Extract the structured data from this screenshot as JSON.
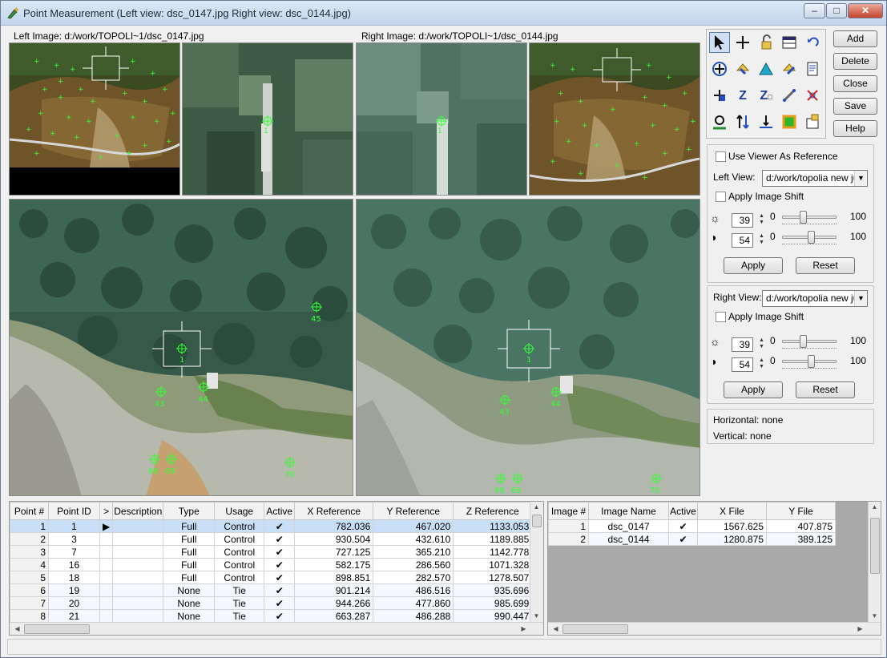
{
  "window": {
    "title": "Point Measurement (Left view: dsc_0147.jpg  Right view: dsc_0144.jpg)",
    "minimize": "–",
    "maximize": "□",
    "close": "✕"
  },
  "left_image_label": "Left Image: d:/work/TOPOLI~1/dsc_0147.jpg",
  "right_image_label": "Right Image: d:/work/TOPOLI~1/dsc_0144.jpg",
  "main_view_points": {
    "left": [
      "1",
      "45",
      "43",
      "44",
      "68",
      "69",
      "70"
    ],
    "right": [
      "1",
      "43",
      "44",
      "68",
      "69",
      "70"
    ]
  },
  "buttons": {
    "add": "Add",
    "delete": "Delete",
    "close": "Close",
    "save": "Save",
    "help": "Help"
  },
  "toolbar_icons": [
    "select-arrow-icon",
    "crosshair-icon",
    "lock-icon",
    "table-view-icon",
    "undo-icon",
    "drive-icon",
    "create-point-icon",
    "triangle-icon",
    "copy-point-icon",
    "report-icon",
    "add-point-icon",
    "z-value-icon",
    "z-update-icon",
    "link-icon",
    "delete-point-icon",
    "navigate-icon",
    "swap-icon",
    "level-icon",
    "color-icon",
    "properties-icon"
  ],
  "viewer": {
    "use_viewer_as_reference": "Use Viewer As Reference",
    "left_view_label": "Left View:",
    "left_view_value": "d:/work/topolia new ju",
    "right_view_label": "Right View:",
    "right_view_value": "d:/work/topolia new ju",
    "apply_image_shift": "Apply Image Shift",
    "brightness_value": "39",
    "contrast_value": "54",
    "slider_min": "0",
    "slider_max": "100",
    "brightness_level": 39,
    "contrast_level": 54,
    "apply": "Apply",
    "reset": "Reset"
  },
  "info": {
    "horizontal": "Horizontal: none",
    "vertical": "Vertical: none"
  },
  "points_table": {
    "headers": [
      "Point #",
      "Point ID",
      ">",
      "Description",
      "Type",
      "Usage",
      "Active",
      "X Reference",
      "Y Reference",
      "Z Reference"
    ],
    "rows": [
      [
        "1",
        "1",
        "▶",
        "",
        "Full",
        "Control",
        "✔",
        "782.036",
        "467.020",
        "1133.053"
      ],
      [
        "2",
        "3",
        "",
        "",
        "Full",
        "Control",
        "✔",
        "930.504",
        "432.610",
        "1189.885"
      ],
      [
        "3",
        "7",
        "",
        "",
        "Full",
        "Control",
        "✔",
        "727.125",
        "365.210",
        "1142.778"
      ],
      [
        "4",
        "16",
        "",
        "",
        "Full",
        "Control",
        "✔",
        "582.175",
        "286.560",
        "1071.328"
      ],
      [
        "5",
        "18",
        "",
        "",
        "Full",
        "Control",
        "✔",
        "898.851",
        "282.570",
        "1278.507"
      ],
      [
        "6",
        "19",
        "",
        "",
        "None",
        "Tie",
        "✔",
        "901.214",
        "486.516",
        "935.696"
      ],
      [
        "7",
        "20",
        "",
        "",
        "None",
        "Tie",
        "✔",
        "944.266",
        "477.860",
        "985.699"
      ],
      [
        "8",
        "21",
        "",
        "",
        "None",
        "Tie",
        "✔",
        "663.287",
        "486.288",
        "990.447"
      ]
    ]
  },
  "images_table": {
    "headers": [
      "Image #",
      "Image Name",
      "Active",
      "X File",
      "Y File"
    ],
    "rows": [
      [
        "1",
        "dsc_0147",
        "✔",
        "1567.625",
        "407.875"
      ],
      [
        "2",
        "dsc_0144",
        "✔",
        "1280.875",
        "389.125"
      ]
    ]
  }
}
